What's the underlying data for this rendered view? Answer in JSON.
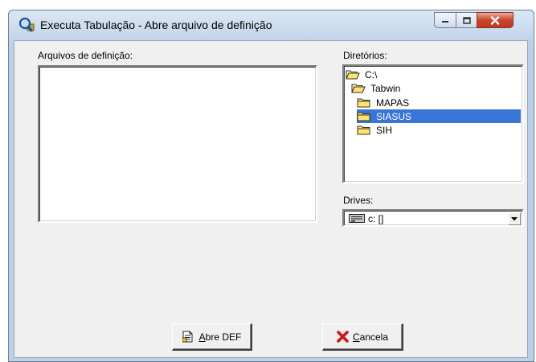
{
  "window": {
    "title": "Executa Tabulação - Abre arquivo de definição",
    "icon": "magnifier-tab-icon"
  },
  "definition_files": {
    "label": "Arquivos de definição:",
    "items": []
  },
  "directories": {
    "label": "Diretórios:",
    "items": [
      {
        "name": "C:\\",
        "icon": "open-folder-icon",
        "selected": false
      },
      {
        "name": "Tabwin",
        "icon": "open-folder-icon",
        "selected": false
      },
      {
        "name": "MAPAS",
        "icon": "folder-icon",
        "selected": false
      },
      {
        "name": "SIASUS",
        "icon": "folder-icon",
        "selected": true
      },
      {
        "name": "SIH",
        "icon": "folder-icon",
        "selected": false
      }
    ]
  },
  "drives": {
    "label": "Drives:",
    "selected": "c: []"
  },
  "buttons": {
    "open": {
      "accel": "A",
      "rest": "bre DEF"
    },
    "cancel": {
      "accel": "C",
      "rest": "ancela"
    }
  },
  "colors": {
    "selection": "#3875d7",
    "close_button": "#c9462c"
  }
}
